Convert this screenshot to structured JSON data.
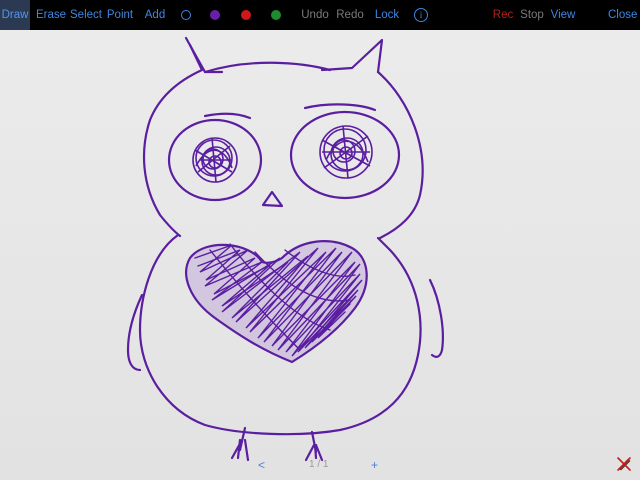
{
  "toolbar": {
    "tools": {
      "draw": "Draw",
      "erase": "Erase",
      "select": "Select",
      "point": "Point",
      "add": "Add"
    },
    "active_tool": "Draw",
    "colors": {
      "selected_outline": "#3f86e0",
      "purple": "#6a1fa8",
      "red": "#d01818",
      "green": "#1f8a2e"
    },
    "undo": "Undo",
    "redo": "Redo",
    "lock": "Lock",
    "info_icon": "i",
    "record": "Rec",
    "stop": "Stop",
    "view": "View",
    "close": "Close"
  },
  "canvas": {
    "stroke_color": "#5a1ea0"
  },
  "bottom": {
    "prev": "<",
    "page_indicator": "1 / 1",
    "next": "+",
    "clear_icon": "clear-pen-icon"
  }
}
